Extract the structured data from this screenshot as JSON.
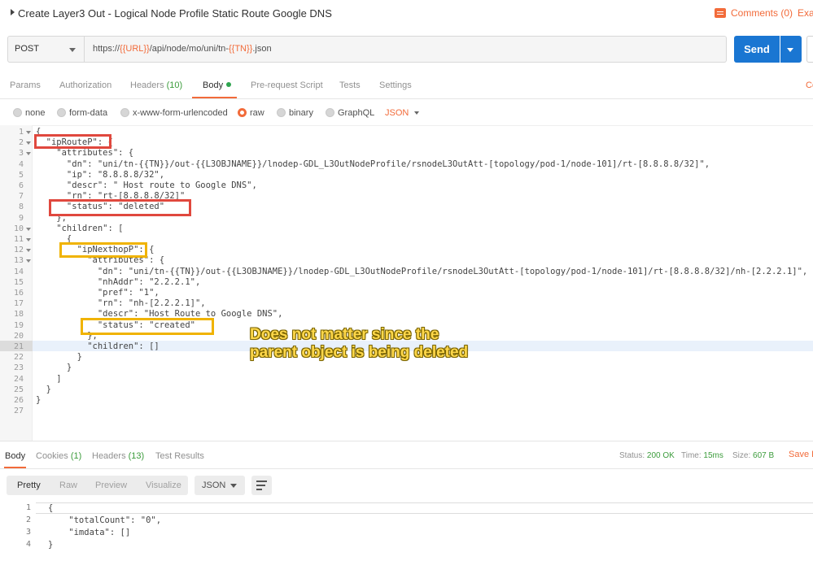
{
  "window": {
    "title": "Create Layer3 Out - Logical Node Profile Static Route Google DNS",
    "comments_label": "Comments (0)",
    "examples_label": "Exa"
  },
  "request": {
    "method": "POST",
    "url_prefix": "https://",
    "url_var1": "{{URL}}",
    "url_mid": "/api/node/mo/uni/tn-",
    "url_var2": "{{TN}}",
    "url_suffix": ".json",
    "send_label": "Send"
  },
  "request_tabs": [
    {
      "label": "Params"
    },
    {
      "label": "Authorization"
    },
    {
      "label": "Headers",
      "count": "(10)"
    },
    {
      "label": "Body"
    },
    {
      "label": "Pre-request Script"
    },
    {
      "label": "Tests"
    },
    {
      "label": "Settings"
    }
  ],
  "cookies_cut": "Co",
  "body_types": {
    "none": "none",
    "form_data": "form-data",
    "urlencoded": "x-www-form-urlencoded",
    "raw": "raw",
    "binary": "binary",
    "graphql": "GraphQL",
    "format": "JSON"
  },
  "code_lines": [
    {
      "n": "1",
      "text": "{"
    },
    {
      "n": "2",
      "text": "  \"ipRouteP\": {"
    },
    {
      "n": "3",
      "text": "    \"attributes\": {"
    },
    {
      "n": "4",
      "text": "      \"dn\": \"uni/tn-{{TN}}/out-{{L3OBJNAME}}/lnodep-GDL_L3OutNodeProfile/rsnodeL3OutAtt-[topology/pod-1/node-101]/rt-[8.8.8.8/32]\","
    },
    {
      "n": "5",
      "text": "      \"ip\": \"8.8.8.8/32\","
    },
    {
      "n": "6",
      "text": "      \"descr\": \" Host route to Google DNS\","
    },
    {
      "n": "7",
      "text": "      \"rn\": \"rt-[8.8.8.8/32]\""
    },
    {
      "n": "8",
      "text": "      \"status\": \"deleted\""
    },
    {
      "n": "9",
      "text": "    },"
    },
    {
      "n": "10",
      "text": "    \"children\": ["
    },
    {
      "n": "11",
      "text": "      {"
    },
    {
      "n": "12",
      "text": "        \"ipNexthopP\": {"
    },
    {
      "n": "13",
      "text": "          \"attributes\": {"
    },
    {
      "n": "14",
      "text": "            \"dn\": \"uni/tn-{{TN}}/out-{{L3OBJNAME}}/lnodep-GDL_L3OutNodeProfile/rsnodeL3OutAtt-[topology/pod-1/node-101]/rt-[8.8.8.8/32]/nh-[2.2.2.1]\","
    },
    {
      "n": "15",
      "text": "            \"nhAddr\": \"2.2.2.1\","
    },
    {
      "n": "16",
      "text": "            \"pref\": \"1\","
    },
    {
      "n": "17",
      "text": "            \"rn\": \"nh-[2.2.2.1]\","
    },
    {
      "n": "18",
      "text": "            \"descr\": \"Host Route to Google DNS\","
    },
    {
      "n": "19",
      "text": "            \"status\": \"created\""
    },
    {
      "n": "20",
      "text": "          },"
    },
    {
      "n": "21",
      "text": "          \"children\": []"
    },
    {
      "n": "22",
      "text": "        }"
    },
    {
      "n": "23",
      "text": "      }"
    },
    {
      "n": "24",
      "text": "    ]"
    },
    {
      "n": "25",
      "text": "  }"
    },
    {
      "n": "26",
      "text": "}"
    },
    {
      "n": "27",
      "text": ""
    }
  ],
  "annotation": {
    "line1": "Does not matter since the",
    "line2": "parent object is being deleted"
  },
  "response_tabs": [
    {
      "label": "Body"
    },
    {
      "label": "Cookies",
      "count": "(1)"
    },
    {
      "label": "Headers",
      "count": "(13)"
    },
    {
      "label": "Test Results"
    }
  ],
  "response_meta": {
    "status_label": "Status:",
    "status_value": "200 OK",
    "time_label": "Time:",
    "time_value": "15ms",
    "size_label": "Size:",
    "size_value": "607 B",
    "save_label": "Save R"
  },
  "response_view": {
    "pretty": "Pretty",
    "raw": "Raw",
    "preview": "Preview",
    "visualize": "Visualize",
    "format": "JSON"
  },
  "response_lines": [
    {
      "n": "1",
      "text": "{"
    },
    {
      "n": "2",
      "text": "    \"totalCount\": \"0\","
    },
    {
      "n": "3",
      "text": "    \"imdata\": []"
    },
    {
      "n": "4",
      "text": "}"
    }
  ],
  "colors": {
    "accent": "#f26b3a",
    "send": "#1a76d2",
    "red_box": "#e0483e",
    "yellow_box": "#f0b300",
    "annotation": "#ffd84a"
  }
}
